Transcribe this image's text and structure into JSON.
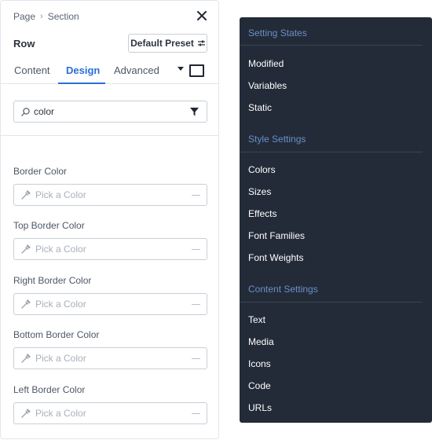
{
  "breadcrumb": {
    "parent": "Page",
    "current": "Section"
  },
  "header": {
    "title": "Row",
    "preset_label": "Default Preset"
  },
  "tabs": [
    {
      "label": "Content",
      "active": false
    },
    {
      "label": "Design",
      "active": true
    },
    {
      "label": "Advanced",
      "active": false
    }
  ],
  "search": {
    "value": "color",
    "placeholder": ""
  },
  "fields": [
    {
      "label": "Border Color",
      "placeholder": "Pick a Color"
    },
    {
      "label": "Top Border Color",
      "placeholder": "Pick a Color"
    },
    {
      "label": "Right Border Color",
      "placeholder": "Pick a Color"
    },
    {
      "label": "Bottom Border Color",
      "placeholder": "Pick a Color"
    },
    {
      "label": "Left Border Color",
      "placeholder": "Pick a Color"
    }
  ],
  "filter_menu": {
    "groups": [
      {
        "heading": "Setting States",
        "items": [
          "Modified",
          "Variables",
          "Static"
        ]
      },
      {
        "heading": "Style Settings",
        "items": [
          "Colors",
          "Sizes",
          "Effects",
          "Font Families",
          "Font Weights"
        ]
      },
      {
        "heading": "Content Settings",
        "items": [
          "Text",
          "Media",
          "Icons",
          "Code",
          "URLs"
        ]
      }
    ]
  },
  "colors": {
    "accent": "#2b6fd6",
    "menu_bg": "#232b38",
    "menu_heading": "#6a8fc9"
  },
  "icons": [
    "close-icon",
    "preset-sliders-icon",
    "caret-down-icon",
    "view-toggle-icon",
    "search-icon",
    "filter-icon",
    "eyedropper-icon"
  ]
}
